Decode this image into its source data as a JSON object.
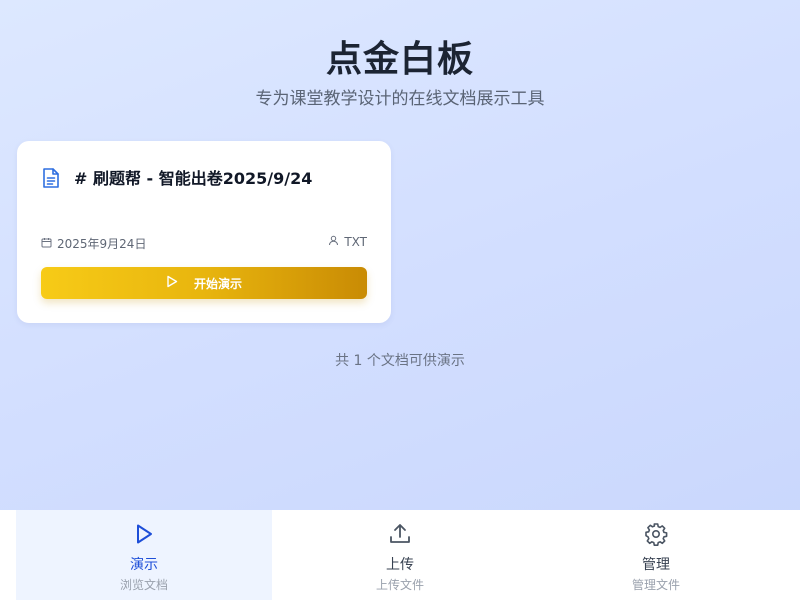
{
  "header": {
    "title": "点金白板",
    "subtitle": "专为课堂教学设计的在线文档展示工具"
  },
  "documents": [
    {
      "icon": "document-icon",
      "title": "# 刷题帮 - 智能出卷2025/9/24",
      "date": "2025年9月24日",
      "type": "TXT",
      "action_label": "开始演示"
    }
  ],
  "footer": {
    "count_text": "共 1 个文档可供演示"
  },
  "nav": {
    "items": [
      {
        "label": "演示",
        "sublabel": "浏览文档",
        "icon": "play-icon",
        "active": true
      },
      {
        "label": "上传",
        "sublabel": "上传文件",
        "icon": "upload-icon",
        "active": false
      },
      {
        "label": "管理",
        "sublabel": "管理文件",
        "icon": "gear-icon",
        "active": false
      }
    ]
  },
  "colors": {
    "accent": "#1d4ed8",
    "button_start": "#f7cb17",
    "button_end": "#c98b04"
  }
}
